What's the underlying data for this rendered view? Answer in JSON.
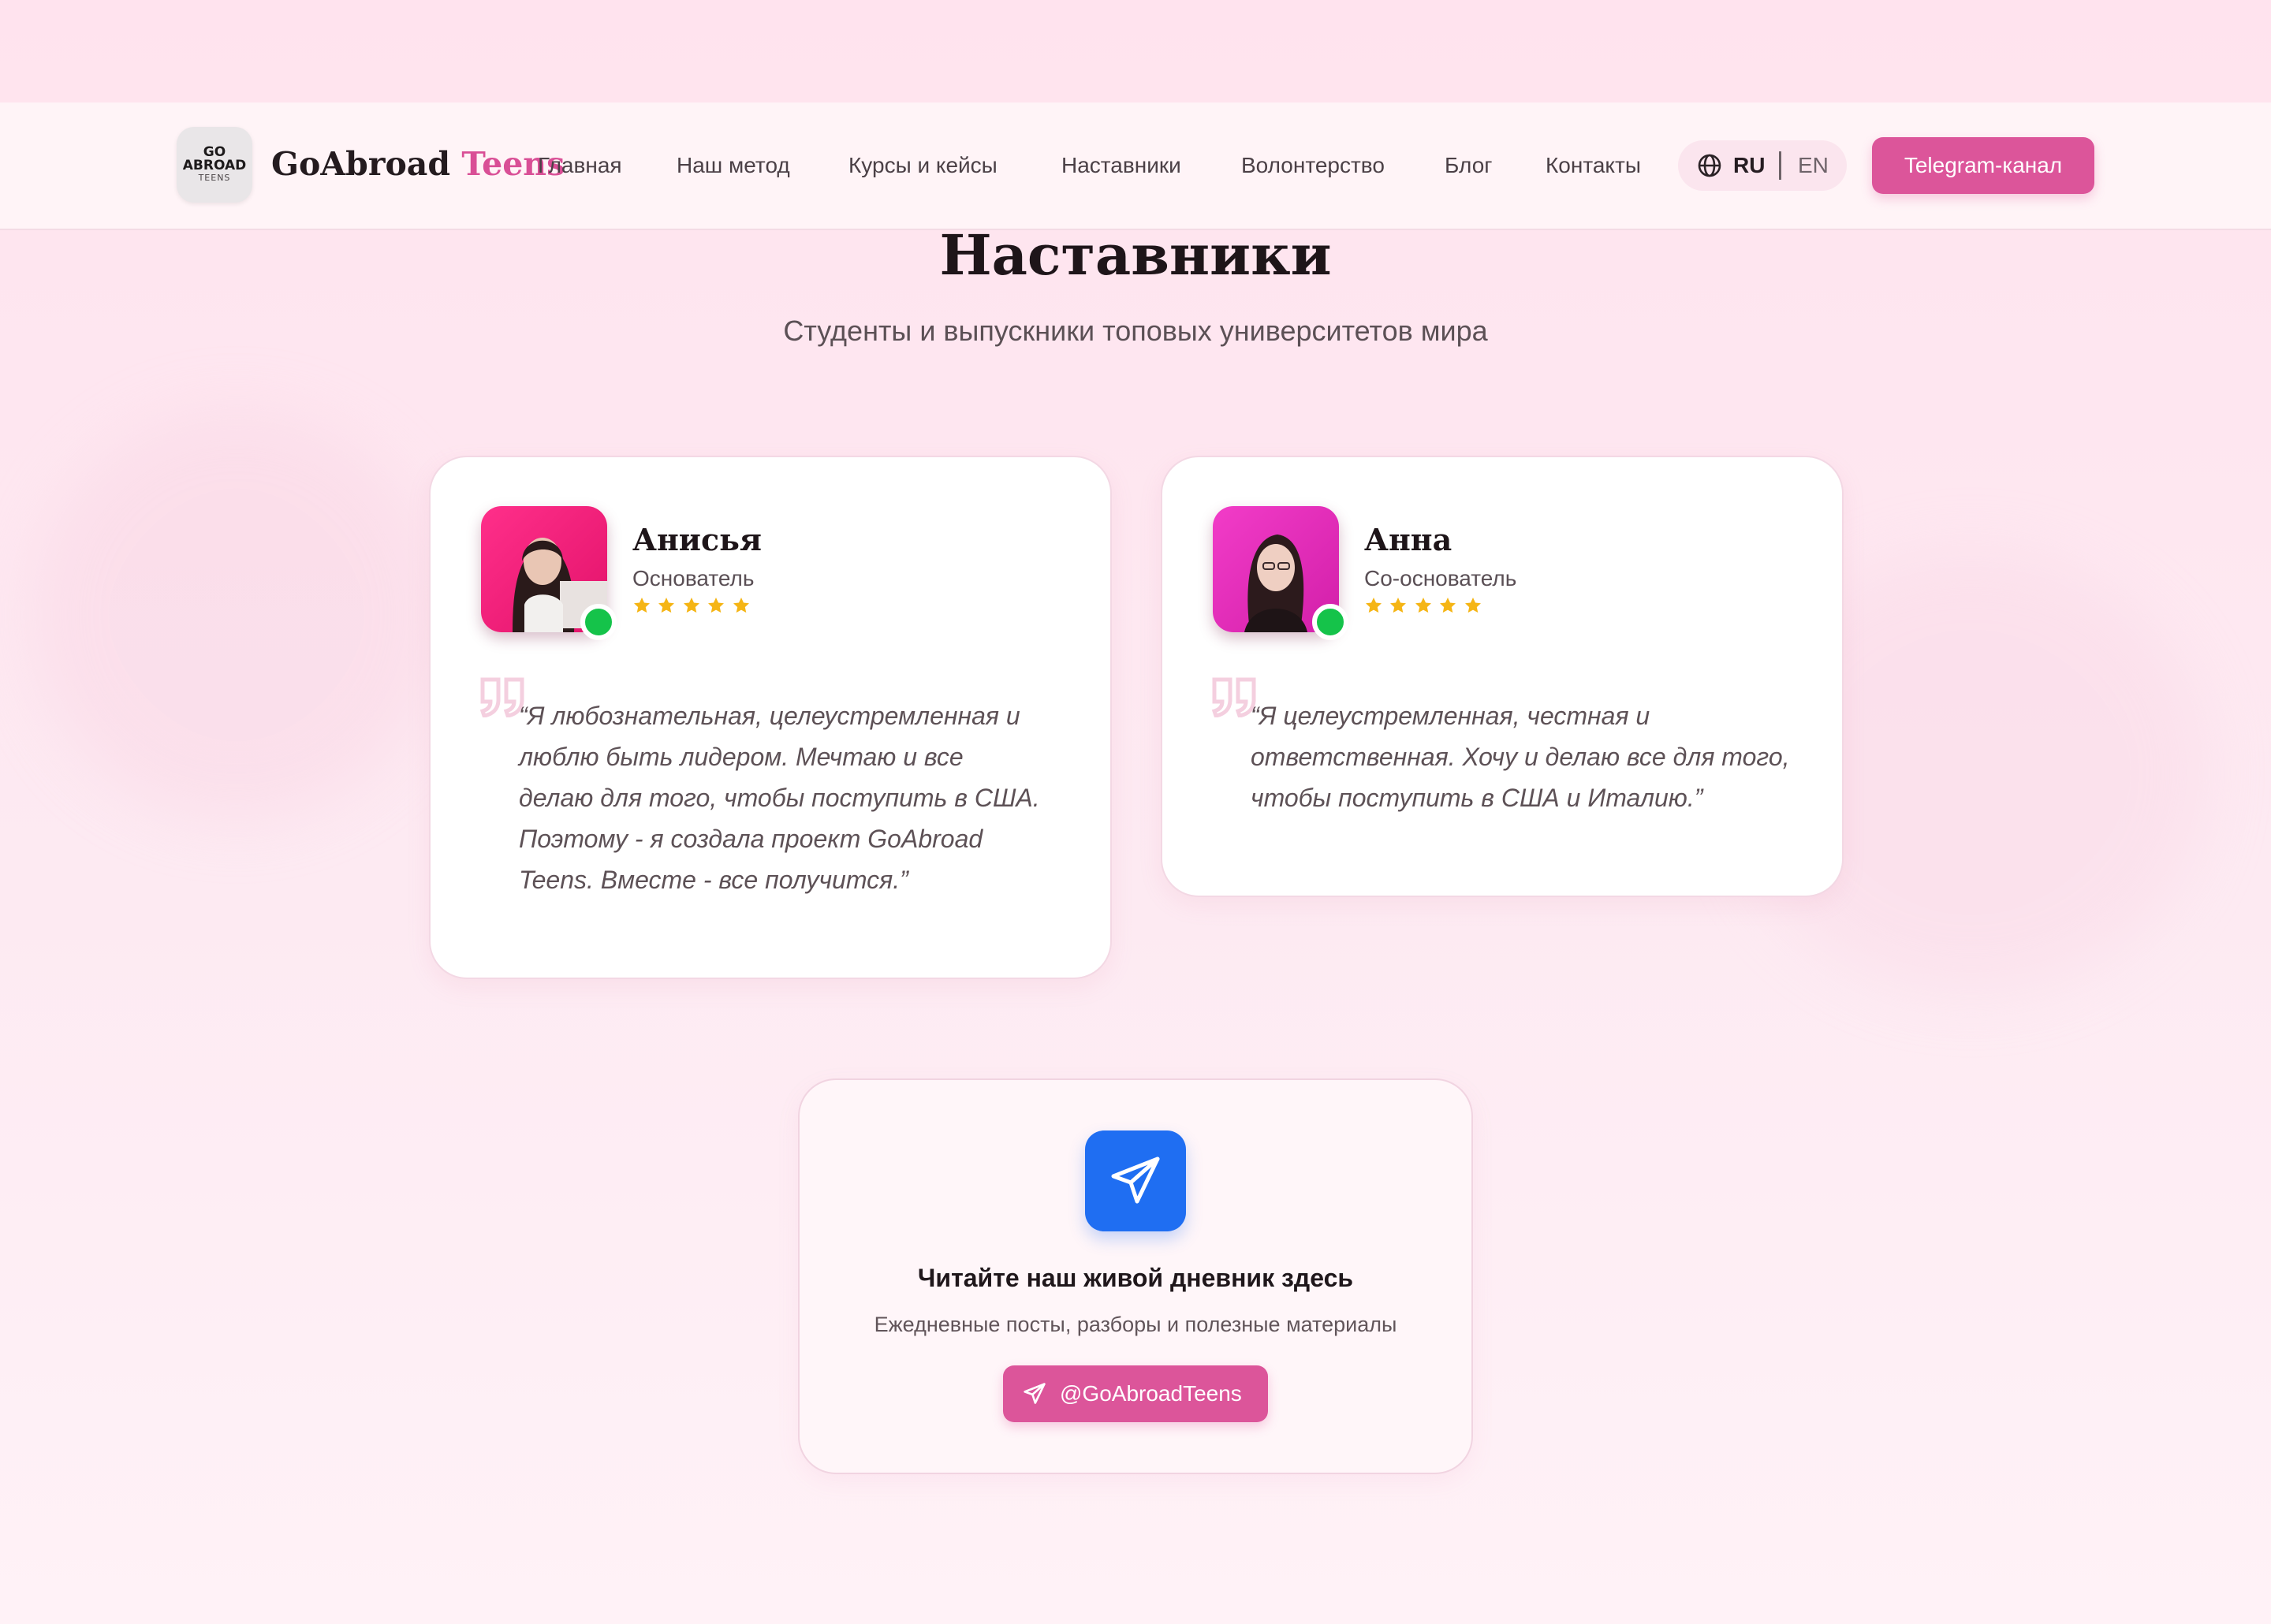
{
  "brand": {
    "logo_line1": "GO",
    "logo_line2": "ABROAD",
    "logo_line3": "TEENS",
    "name_part1": "GoAbroad",
    "name_part2": "Teens",
    "accent_color": "#dc559a"
  },
  "nav": {
    "items": [
      {
        "label": "Главная"
      },
      {
        "label": "Наш метод"
      },
      {
        "label": "Курсы и кейсы"
      },
      {
        "label": "Наставники"
      },
      {
        "label": "Волонтерство"
      },
      {
        "label": "Блог"
      },
      {
        "label": "Контакты"
      }
    ],
    "lang_active": "RU",
    "lang_other": "EN",
    "cta_label": "Telegram-канал"
  },
  "section": {
    "title": "Наставники",
    "subtitle": "Студенты и выпускники топовых университетов мира"
  },
  "mentors": [
    {
      "name": "Анисья",
      "role": "Основатель",
      "rating": 5,
      "status": "online",
      "quote": "“Я любознательная, целеустремленная и\nлюблю быть лидером. Мечтаю и все\nделаю для того, чтобы поступить в США.\nПоэтому - я создала проект GoAbroad\nTeens. Вместе - все получится.”"
    },
    {
      "name": "Анна",
      "role": "Со-основатель",
      "rating": 5,
      "status": "online",
      "quote": "“Я целеустремленная, честная и\nответственная. Хочу и делаю все для того,\nчтобы поступить в США и Италию.”"
    }
  ],
  "telegram": {
    "icon": "paper-plane-icon",
    "title": "Читайте наш живой дневник здесь",
    "subtitle": "Ежедневные посты, разборы и полезные материалы",
    "handle": "@GoAbroadTeens",
    "icon_bg": "#1f6ef2"
  }
}
